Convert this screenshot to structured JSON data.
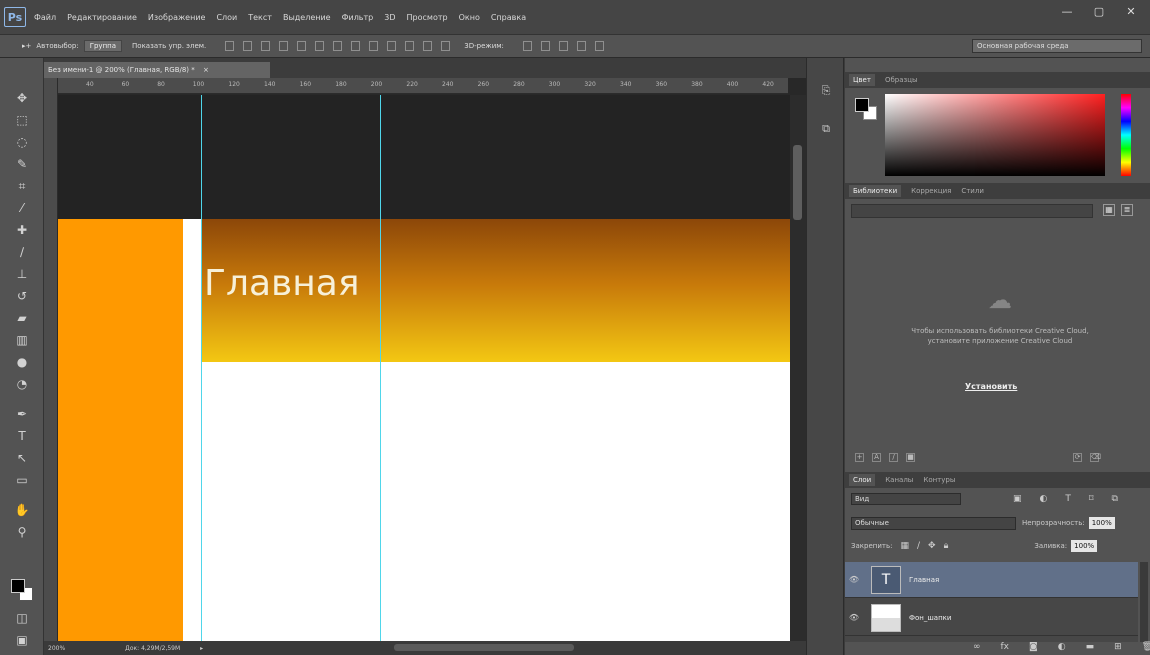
{
  "menubar": {
    "logo": "Ps",
    "items": [
      "Файл",
      "Редактирование",
      "Изображение",
      "Слои",
      "Текст",
      "Выделение",
      "Фильтр",
      "3D",
      "Просмотр",
      "Окно",
      "Справка"
    ],
    "controls": [
      "—",
      "▢",
      "✕"
    ]
  },
  "options": {
    "autoselect_label": "Автовыбор:",
    "autoselect_value": "Группа",
    "show_controls_label": "Показать упр. элем.",
    "mode_3d_label": "3D-режим:",
    "workspace": "Основная рабочая среда"
  },
  "document": {
    "tab_title": "Без имени-1 @ 200% (Главная, RGB/8) *",
    "heading": "Главная",
    "ruler_ticks": [
      "40",
      "60",
      "80",
      "100",
      "120",
      "140",
      "160",
      "180",
      "200",
      "220",
      "240",
      "260",
      "280",
      "300",
      "320",
      "340",
      "360",
      "380",
      "400",
      "420"
    ],
    "status_zoom": "200%",
    "status_doc": "Док: 4,29M/2,59M"
  },
  "colors": {
    "accent_orange": "#ff9900",
    "header_dark": "#8c4709",
    "header_light": "#f3c713",
    "guide": "#4fd6ea",
    "selected_layer": "#617089"
  },
  "panels": {
    "color_tabs": [
      "Цвет",
      "Образцы"
    ],
    "library_tabs": [
      "Библиотеки",
      "Коррекция",
      "Стили"
    ],
    "library_message": "Чтобы использовать библиотеки Creative Cloud, установите приложение Creative Cloud",
    "install_label": "Установить",
    "layers_tabs": [
      "Слои",
      "Каналы",
      "Контуры"
    ],
    "filter_value": "Вид",
    "blend_mode": "Обычные",
    "opacity_label": "Непрозрачность:",
    "opacity_value": "100%",
    "lock_label": "Закрепить:",
    "fill_label": "Заливка:",
    "fill_value": "100%",
    "layers": [
      {
        "name": "Главная",
        "selected": true,
        "thumb": "T"
      },
      {
        "name": "Фон_шапки",
        "selected": false,
        "thumb": ""
      }
    ]
  },
  "icons": {
    "tools": [
      "move-icon",
      "marquee-icon",
      "lasso-icon",
      "quick-select-icon",
      "crop-icon",
      "eyedropper-icon",
      "healing-icon",
      "brush-icon",
      "stamp-icon",
      "history-brush-icon",
      "eraser-icon",
      "gradient-icon",
      "blur-icon",
      "dodge-icon",
      "pen-icon",
      "type-icon",
      "path-select-icon",
      "shape-icon",
      "hand-icon",
      "zoom-icon"
    ]
  }
}
